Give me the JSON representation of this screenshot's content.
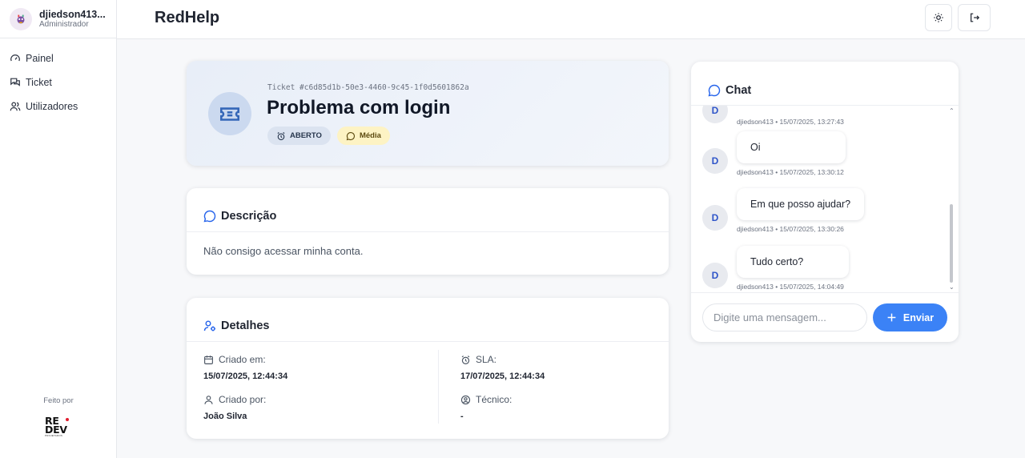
{
  "user": {
    "name": "djiedson413...",
    "role": "Administrador"
  },
  "sidebar": {
    "items": [
      {
        "label": "Painel",
        "icon": "gauge-icon"
      },
      {
        "label": "Ticket",
        "icon": "chat-icon"
      },
      {
        "label": "Utilizadores",
        "icon": "users-icon"
      }
    ],
    "made_by": "Feito por",
    "logo_text": "RE DEV"
  },
  "header": {
    "brand": "RedHelp",
    "theme_icon": "sun-icon",
    "logout_icon": "logout-icon"
  },
  "ticket": {
    "id_label": "Ticket #c6d85d1b-50e3-4460-9c45-1f0d5601862a",
    "title": "Problema com login",
    "status": "ABERTO",
    "priority": "Média"
  },
  "description": {
    "title": "Descrição",
    "text": "Não consigo acessar minha conta."
  },
  "details": {
    "title": "Detalhes",
    "created_at_label": "Criado em:",
    "created_at": "15/07/2025, 12:44:34",
    "sla_label": "SLA:",
    "sla": "17/07/2025, 12:44:34",
    "created_by_label": "Criado por:",
    "created_by": "João Silva",
    "technician_label": "Técnico:",
    "technician": "-"
  },
  "chat": {
    "title": "Chat",
    "messages": [
      {
        "avatar": "D",
        "text": "",
        "meta": "djiedson413 • 15/07/2025, 13:27:43"
      },
      {
        "avatar": "D",
        "text": "Oi",
        "meta": "djiedson413 • 15/07/2025, 13:30:12"
      },
      {
        "avatar": "D",
        "text": "Em que posso ajudar?",
        "meta": "djiedson413 • 15/07/2025, 13:30:26"
      },
      {
        "avatar": "D",
        "text": "Tudo certo?",
        "meta": "djiedson413 • 15/07/2025, 14:04:49"
      }
    ],
    "input_placeholder": "Digite uma mensagem...",
    "send_label": "Enviar"
  },
  "colors": {
    "accent": "#3b82f6",
    "avatar_letter": "#2f55c9",
    "logo_red": "#e11d2f"
  }
}
